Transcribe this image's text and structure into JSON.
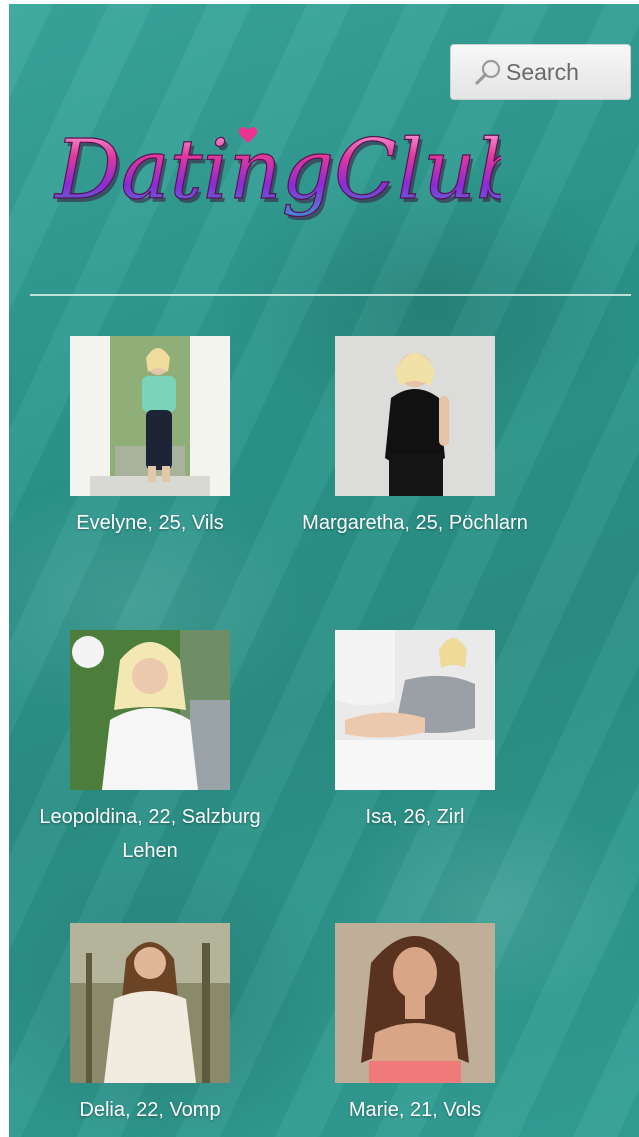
{
  "search": {
    "label": "Search",
    "icon": "search-icon"
  },
  "logo": {
    "text": "DatingClub",
    "colors": [
      "#d83a9c",
      "#f39ad0",
      "#7a2bd8",
      "#3f9ad6"
    ]
  },
  "profiles": [
    {
      "caption": "Evelyne, 25, Vils"
    },
    {
      "caption": "Margaretha, 25, Pöchlarn"
    },
    {
      "caption": "Leopoldina, 22, Salzburg Lehen"
    },
    {
      "caption": "Isa, 26, Zirl"
    },
    {
      "caption": "Delia, 22, Vomp"
    },
    {
      "caption": "Marie, 21, Vols"
    }
  ],
  "colors": {
    "background": "#2e968c",
    "caption_text": "#ffffff",
    "search_bg": "#eeeeee"
  }
}
